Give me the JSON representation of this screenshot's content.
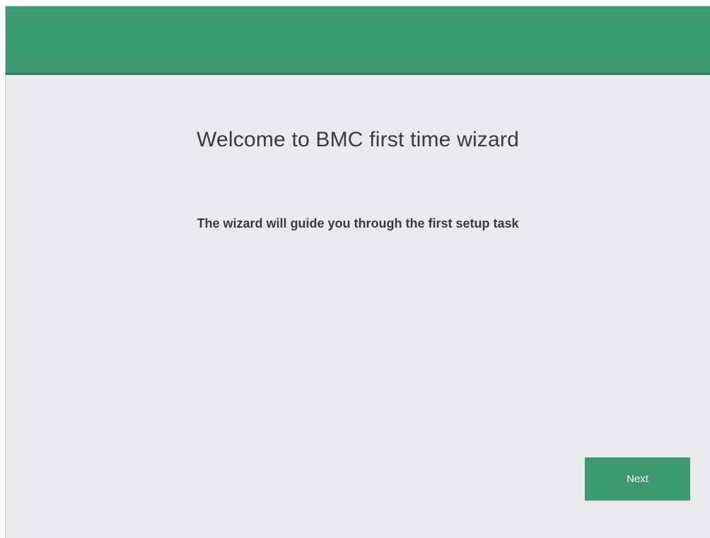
{
  "wizard": {
    "title": "Welcome to BMC first time wizard",
    "subtitle": "The wizard will guide you through the first setup task",
    "next_label": "Next"
  },
  "colors": {
    "accent": "#3d9a71",
    "background": "#eaeaec",
    "text": "#3b3b3b"
  }
}
